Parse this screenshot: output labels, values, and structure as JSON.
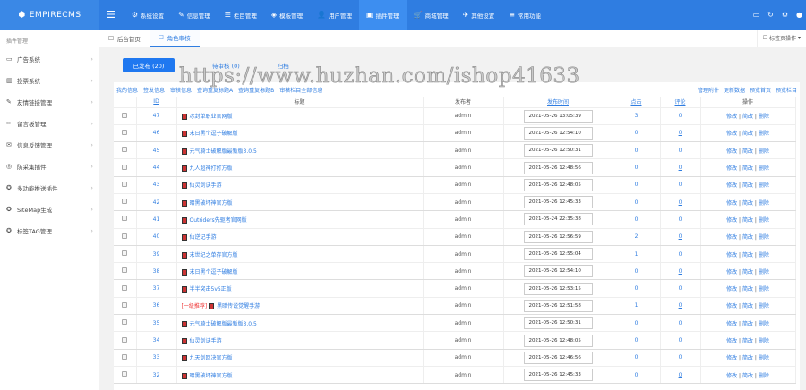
{
  "header": {
    "logo": "EMPIRECMS",
    "nav": [
      {
        "label": "系统设置",
        "icon": "gear"
      },
      {
        "label": "信息管理",
        "icon": "edit"
      },
      {
        "label": "栏目管理",
        "icon": "list"
      },
      {
        "label": "模板管理",
        "icon": "layers"
      },
      {
        "label": "用户管理",
        "icon": "user"
      },
      {
        "label": "插件管理",
        "icon": "plugin",
        "active": true
      },
      {
        "label": "商城管理",
        "icon": "cart"
      },
      {
        "label": "其他设置",
        "icon": "wrench"
      },
      {
        "label": "常用功能",
        "icon": "sliders"
      }
    ]
  },
  "sidebar": {
    "title": "插件管理",
    "items": [
      "广告系统",
      "投票系统",
      "友情链接管理",
      "留言板管理",
      "信息反馈管理",
      "防采集插件",
      "多功能推送插件",
      "SiteMap生成",
      "标签TAG管理"
    ]
  },
  "tabs": {
    "items": [
      "后台首页",
      "角色审核"
    ],
    "op": "标签页操作"
  },
  "subtabs": [
    "已发布 (20)",
    "待审核 (0)",
    "归档"
  ],
  "links": {
    "left": [
      "我的信息",
      "签发信息",
      "审核信息",
      "查询重复标题A",
      "查询重复标题B",
      "审核栏目全部信息"
    ],
    "right": [
      "管理附件",
      "更新数据",
      "预览首页",
      "预览栏目"
    ]
  },
  "columns": [
    "ID",
    "标题",
    "发布者",
    "发布时间",
    "点击",
    "评论",
    "操作"
  ],
  "ops": [
    "修改",
    "简改",
    "删除"
  ],
  "rows": [
    {
      "id": "47",
      "title": "冰封单职业官网版",
      "author": "admin",
      "time": "2021-05-26 13:05:39",
      "clicks": "3",
      "comments": "0"
    },
    {
      "id": "46",
      "title": "末日黑个逗子破解版",
      "author": "admin",
      "time": "2021-05-26 12:54:10",
      "clicks": "0",
      "comments": "0"
    },
    {
      "id": "45",
      "title": "元气骑士破解版最新版3.0.5",
      "author": "admin",
      "time": "2021-05-26 12:50:31",
      "clicks": "0",
      "comments": "0"
    },
    {
      "id": "44",
      "title": "九人超神打打方版",
      "author": "admin",
      "time": "2021-05-26 12:48:56",
      "clicks": "0",
      "comments": "0"
    },
    {
      "id": "43",
      "title": "仙灵剑诀手游",
      "author": "admin",
      "time": "2021-05-26 12:48:05",
      "clicks": "0",
      "comments": "0"
    },
    {
      "id": "42",
      "title": "暗黑破坏神官方版",
      "author": "admin",
      "time": "2021-05-26 12:45:33",
      "clicks": "0",
      "comments": "0"
    },
    {
      "id": "41",
      "title": "Outriders先驱者官网版",
      "author": "admin",
      "time": "2021-05-24 22:35:38",
      "clicks": "0",
      "comments": "0"
    },
    {
      "id": "40",
      "title": "仙逆记手游",
      "author": "admin",
      "time": "2021-05-26 12:56:59",
      "clicks": "2",
      "comments": "0"
    },
    {
      "id": "39",
      "title": "末世纪之单存官方版",
      "author": "admin",
      "time": "2021-05-26 12:55:04",
      "clicks": "1",
      "comments": "0"
    },
    {
      "id": "38",
      "title": "末日黑个逗子破解版",
      "author": "admin",
      "time": "2021-05-26 12:54:10",
      "clicks": "0",
      "comments": "0"
    },
    {
      "id": "37",
      "title": "半半突击5v5正版",
      "author": "admin",
      "time": "2021-05-26 12:53:15",
      "clicks": "0",
      "comments": "0"
    },
    {
      "id": "36",
      "tag": "[一级推荐]",
      "title": "黑暗传说觉醒手游",
      "author": "admin",
      "time": "2021-05-26 12:51:58",
      "clicks": "1",
      "comments": "0"
    },
    {
      "id": "35",
      "title": "元气骑士破解版最新版3.0.5",
      "author": "admin",
      "time": "2021-05-26 12:50:31",
      "clicks": "0",
      "comments": "0"
    },
    {
      "id": "34",
      "title": "仙灵剑诀手游",
      "author": "admin",
      "time": "2021-05-26 12:48:05",
      "clicks": "0",
      "comments": "0"
    },
    {
      "id": "33",
      "title": "九天剑回决官方版",
      "author": "admin",
      "time": "2021-05-26 12:46:56",
      "clicks": "0",
      "comments": "0"
    },
    {
      "id": "32",
      "title": "暗黑破坏神官方版",
      "author": "admin",
      "time": "2021-05-26 12:45:33",
      "clicks": "0",
      "comments": "0"
    }
  ],
  "watermark": "https://www.huzhan.com/ishop41633"
}
